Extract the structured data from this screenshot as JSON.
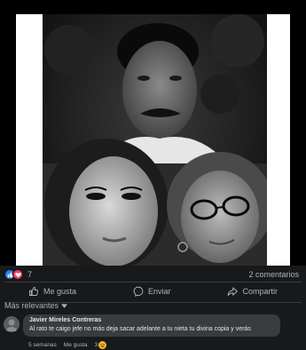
{
  "reactions": {
    "count": "7",
    "icons": [
      "like-icon",
      "love-icon"
    ],
    "comments_label": "2 comentarios"
  },
  "actions": {
    "like_label": "Me gusta",
    "send_label": "Enviar",
    "share_label": "Compartir"
  },
  "sort": {
    "label": "Más relevantes"
  },
  "comment": {
    "author": "Javier Mireles Contreras",
    "text": "Al rato te caigo jefe no más deja sacar adelante a tu nieta tu divina copia y verás",
    "time": "5 semanas",
    "like_label": "Me gusta",
    "reaction_count": "3"
  },
  "colors": {
    "background": "#18191a",
    "bubble": "#3a3b3c",
    "muted_text": "#b0b3b8",
    "like_blue": "#2e81f4",
    "love_red": "#f33e58"
  }
}
